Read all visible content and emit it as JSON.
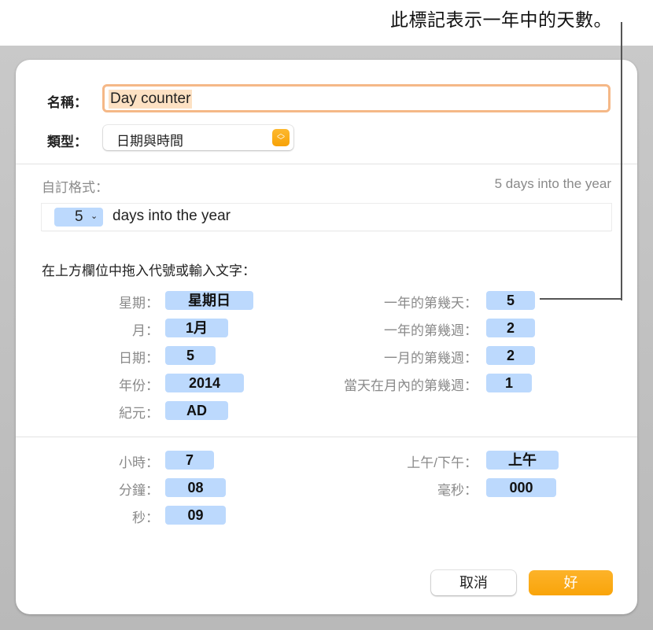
{
  "callout": {
    "text": "此標記表示一年中的天數。"
  },
  "dialog": {
    "name_label": "名稱：",
    "name_value": "Day counter",
    "type_label": "類型：",
    "type_value": "日期與時間",
    "custom_format_label": "自訂格式：",
    "preview": "5 days into the year",
    "format_token": "5",
    "format_suffix": "days into the year",
    "help_text": "在上方欄位中拖入代號或輸入文字：",
    "date_fields_left": [
      {
        "label": "星期：",
        "value": "星期日"
      },
      {
        "label": "月：",
        "value": "1月"
      },
      {
        "label": "日期：",
        "value": "5"
      },
      {
        "label": "年份：",
        "value": "2014"
      },
      {
        "label": "紀元：",
        "value": "AD"
      }
    ],
    "date_fields_right": [
      {
        "label": "一年的第幾天：",
        "value": "5"
      },
      {
        "label": "一年的第幾週：",
        "value": "2"
      },
      {
        "label": "一月的第幾週：",
        "value": "2"
      },
      {
        "label": "當天在月內的第幾週：",
        "value": "1"
      }
    ],
    "time_fields_left": [
      {
        "label": "小時：",
        "value": "7"
      },
      {
        "label": "分鐘：",
        "value": "08"
      },
      {
        "label": "秒：",
        "value": "09"
      }
    ],
    "time_fields_right": [
      {
        "label": "上午/下午：",
        "value": "上午"
      },
      {
        "label": "毫秒：",
        "value": "000"
      }
    ],
    "cancel_label": "取消",
    "ok_label": "好",
    "accent_color": "#f9a40a",
    "token_color": "#bcd9fd"
  }
}
